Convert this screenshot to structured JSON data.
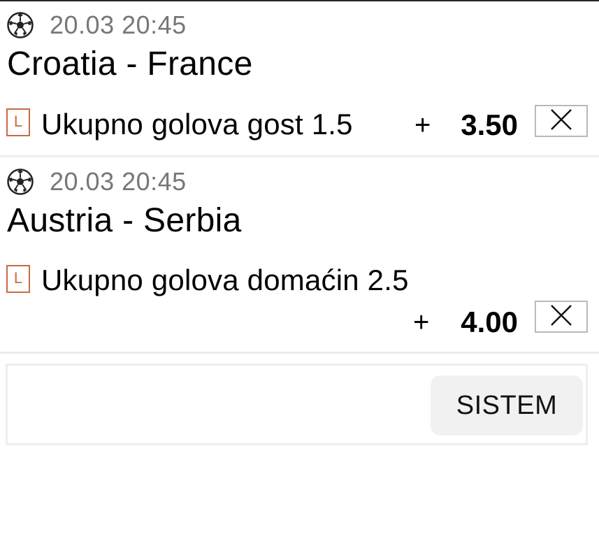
{
  "bets": [
    {
      "sport_icon": "soccer-ball-icon",
      "datetime": "20.03 20:45",
      "match": "Croatia - France",
      "live_badge": "L",
      "market": "Ukupno golova gost 1.5",
      "sign": "+",
      "odds": "3.50",
      "remove_icon": "close-icon"
    },
    {
      "sport_icon": "soccer-ball-icon",
      "datetime": "20.03 20:45",
      "match": "Austria - Serbia",
      "live_badge": "L",
      "market": "Ukupno golova domaćin 2.5",
      "sign": "+",
      "odds": "4.00",
      "remove_icon": "close-icon"
    }
  ],
  "system": {
    "button_label": "SISTEM"
  },
  "colors": {
    "live_badge": "#c96a45",
    "datetime": "#777777",
    "divider": "#ececec",
    "button_bg": "#f1f1f1"
  }
}
